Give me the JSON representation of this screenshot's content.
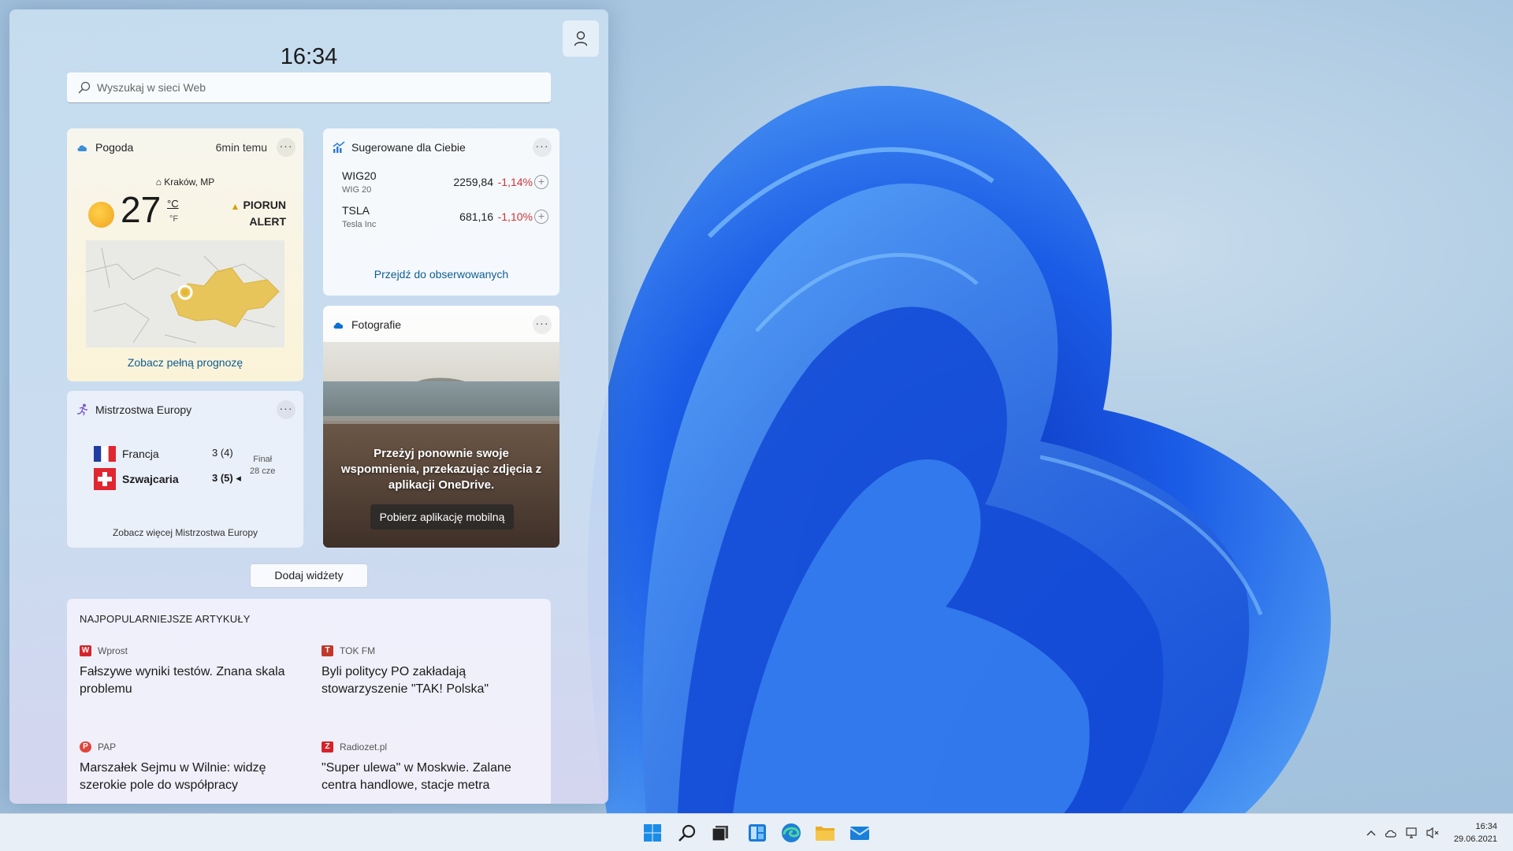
{
  "panel": {
    "clock": "16:34",
    "search": {
      "placeholder": "Wyszukaj w sieci Web"
    }
  },
  "weather": {
    "title": "Pogoda",
    "updated": "6min temu",
    "more": "···",
    "location": "Kraków, MP",
    "temperature": "27",
    "unit_c": "°C",
    "unit_f": "°F",
    "alert_line1": "PIORUN",
    "alert_line2": "ALERT",
    "link": "Zobacz pełną prognozę"
  },
  "stocks": {
    "title": "Sugerowane dla Ciebie",
    "more": "···",
    "items": [
      {
        "symbol": "WIG20",
        "name": "WIG 20",
        "price": "2259,84",
        "change": "-1,14%"
      },
      {
        "symbol": "TSLA",
        "name": "Tesla Inc",
        "price": "681,16",
        "change": "-1,10%"
      }
    ],
    "link": "Przejdź do obserwowanych"
  },
  "photos": {
    "title": "Fotografie",
    "more": "···",
    "text": "Przeżyj ponownie swoje wspomnienia, przekazując zdjęcia z aplikacji OneDrive.",
    "button": "Pobierz aplikację mobilną"
  },
  "euro": {
    "title": "Mistrzostwa Europy",
    "more": "···",
    "teams": [
      {
        "name": "Francja",
        "score": "3 (4)"
      },
      {
        "name": "Szwajcaria",
        "score": "3 (5) ◂"
      }
    ],
    "final_label": "Finał",
    "final_date": "28 cze",
    "link": "Zobacz więcej Mistrzostwa Europy"
  },
  "add_widgets": "Dodaj widżety",
  "articles": {
    "title": "NAJPOPULARNIEJSZE ARTYKUŁY",
    "items": [
      {
        "source": "Wprost",
        "title": "Fałszywe wyniki testów. Znana skala problemu",
        "logo": "W",
        "color": "#d6232a"
      },
      {
        "source": "TOK FM",
        "title": "Byli politycy PO zakładają stowarzyszenie \"TAK! Polska\"",
        "logo": "T",
        "color": "#c0392b"
      },
      {
        "source": "PAP",
        "title": "Marszałek Sejmu w Wilnie: widzę szerokie pole do współpracy",
        "logo": "P",
        "color": "#e0463c"
      },
      {
        "source": "Radiozet.pl",
        "title": "\"Super ulewa\" w Moskwie. Zalane centra handlowe, stacje metra",
        "logo": "Z",
        "color": "#d6232a"
      }
    ]
  },
  "taskbar": {
    "apps": [
      "start-icon",
      "search-icon",
      "task-view-icon",
      "widgets-icon",
      "edge-icon",
      "file-explorer-icon",
      "mail-icon"
    ],
    "time": "16:34",
    "date": "29.06.2021"
  }
}
